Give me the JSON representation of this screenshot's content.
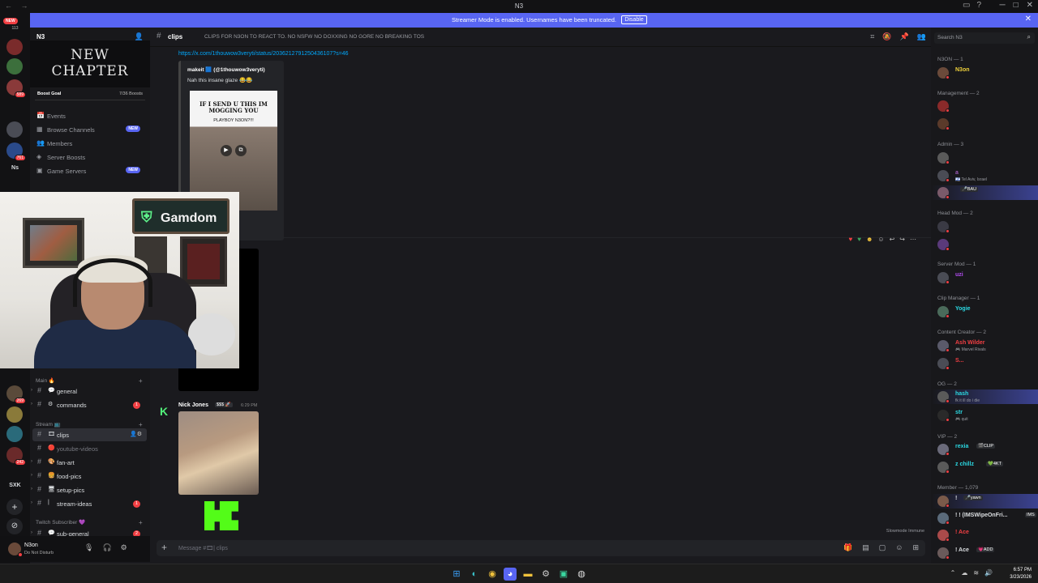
{
  "window": {
    "title": "N3"
  },
  "banner": {
    "text": "Streamer Mode is enabled. Usernames have been truncated.",
    "disable_label": "Disable"
  },
  "guilds": {
    "new_label": "NEW",
    "top_label": "113",
    "badges": [
      "589",
      "761",
      "269",
      "242"
    ],
    "labels": [
      "Ns",
      "SXK"
    ]
  },
  "server": {
    "name": "N3",
    "banner_text": "NEW CHAPTER",
    "boost_label": "Boost Goal",
    "boost_count": "7/36 Boosts",
    "nav": [
      {
        "label": "Events",
        "icon": "📅"
      },
      {
        "label": "Browse Channels",
        "icon": "▦",
        "badge": "NEW"
      },
      {
        "label": "Members",
        "icon": "👥"
      },
      {
        "label": "Server Boosts",
        "icon": "◈"
      },
      {
        "label": "Game Servers",
        "icon": "▣",
        "badge": "NEW"
      }
    ],
    "categories": {
      "main": "Main 🔥",
      "stream": "Stream 📺",
      "twitch": "Twitch Subscriber 💜"
    },
    "channels": [
      {
        "emoji": "💬",
        "name": "general"
      },
      {
        "emoji": "⚙",
        "name": "commands",
        "count": "1"
      },
      {
        "emoji": "🎞",
        "name": "clips"
      },
      {
        "emoji": "🔴",
        "name": "youtube-videos"
      },
      {
        "emoji": "🎨",
        "name": "fan-art"
      },
      {
        "emoji": "🍔",
        "name": "food-pics"
      },
      {
        "emoji": "🖥",
        "name": "setup-pics"
      },
      {
        "emoji": "|",
        "name": "stream-ideas",
        "count": "1"
      },
      {
        "emoji": "💬",
        "name": "sub-general",
        "count": "2"
      }
    ]
  },
  "user": {
    "name": "N3on",
    "status": "Do Not Disturb"
  },
  "webcam": {
    "sponsor": "Gamdom"
  },
  "channel": {
    "name": "clips",
    "topic": "CLIPS FOR N3ON TO REACT TO. NO NSFW NO DOXXING NO GORE NO BREAKING TOS"
  },
  "messages": {
    "link": "https://x.com/1thouwow3veryti/status/2036212791250436107?s=46",
    "embed_author": "makeit 🟦 (@1thouwow3veryti)",
    "embed_desc": "Nah this insane glaze 😂😂",
    "thumb_text": "IF I SEND U THIS IM MOGGING YOU",
    "thumb_sub": "PLAYBOY N3ON?!!!",
    "second_author": "Nick Jones",
    "second_tag": "$$$ 🚀",
    "second_time": "6:29 PM",
    "slowmode": "Slowmode Immune"
  },
  "composer": {
    "placeholder": "Message #🎞| clips"
  },
  "search": {
    "placeholder": "Search N3"
  },
  "members": {
    "categories": [
      "N3ON — 1",
      "Management — 2",
      "Admin — 3",
      "Head Mod — 2",
      "Server Mod — 1",
      "Clip Manager — 1",
      "Content Creator — 2",
      "OG — 2",
      "VIP — 2",
      "Member — 1,079"
    ],
    "list": [
      {
        "name": "N3on",
        "color": "#f0d23c"
      },
      {
        "name": "",
        "color": "#f23f43"
      },
      {
        "name": "",
        "color": "#5865f2"
      },
      {
        "name": "",
        "color": "#9b59b6"
      },
      {
        "name": "a",
        "sub": "🇮🇱 Tel Aviv, Israel",
        "color": "#9b59b6"
      },
      {
        "name": "",
        "tag": "🎤BAU",
        "color": "#9b59b6"
      },
      {
        "name": "",
        "color": "#f23f43"
      },
      {
        "name": "",
        "color": "#f23f43"
      },
      {
        "name": "uzi",
        "color": "#b14cf0"
      },
      {
        "name": "Yogie",
        "color": "#2bd9e3"
      },
      {
        "name": "Ash Wilder",
        "sub": "🎮 Marvel Rivals",
        "color": "#f23f43"
      },
      {
        "name": "S...",
        "color": "#f23f43"
      },
      {
        "name": "hash",
        "sub": "fk it ill do i die",
        "color": "#2bd9e3"
      },
      {
        "name": "str",
        "sub": "🎮 quit",
        "color": "#2bd9e3"
      },
      {
        "name": "rexia",
        "tag": "🎬CLIP",
        "color": "#2bd9e3"
      },
      {
        "name": "z chillz",
        "tag": "💚4KT",
        "color": "#2bd9e3"
      },
      {
        "name": "!",
        "tag": "🎤yawn",
        "color": "#dbdee1"
      },
      {
        "name": "! ! (IMSWipeOnFri...",
        "tag": "IMS",
        "color": "#dbdee1"
      },
      {
        "name": "! Ace",
        "color": "#f23f43"
      },
      {
        "name": "! Ace",
        "tag": "💗ADD",
        "color": "#dbdee1"
      }
    ]
  },
  "taskbar": {
    "time": "6:57 PM",
    "date": "3/23/2026"
  }
}
